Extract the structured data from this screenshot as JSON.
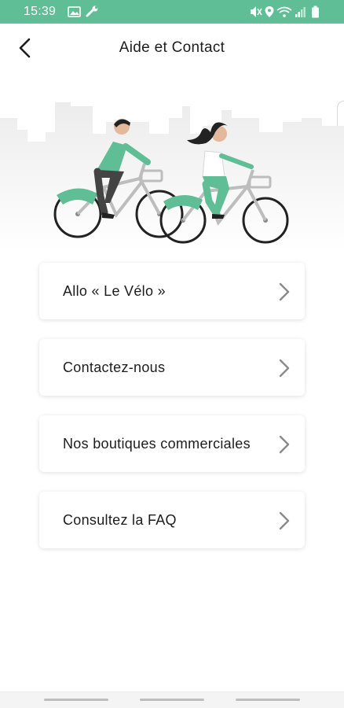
{
  "status_bar": {
    "time": "15:39",
    "background": "#5fbe95",
    "left_icons": [
      "image-icon",
      "wrench-icon"
    ],
    "right_icons": [
      "mute-icon",
      "location-icon",
      "wifi-icon",
      "signal-icon",
      "battery-icon"
    ]
  },
  "header": {
    "title": "Aide et Contact",
    "back_icon": "back-arrow-icon"
  },
  "hero": {
    "illustration": "two cyclists riding bikes in front of city skyline",
    "accent_color": "#5fbe95"
  },
  "menu": {
    "items": [
      {
        "label": "Allo « Le Vélo »",
        "icon": "chevron-right-icon"
      },
      {
        "label": "Contactez-nous",
        "icon": "chevron-right-icon"
      },
      {
        "label": "Nos boutiques commerciales",
        "icon": "chevron-right-icon"
      },
      {
        "label": "Consultez la FAQ",
        "icon": "chevron-right-icon"
      }
    ]
  },
  "nav_bar": {
    "buttons": [
      "recent-apps-button",
      "home-button",
      "back-button"
    ]
  }
}
